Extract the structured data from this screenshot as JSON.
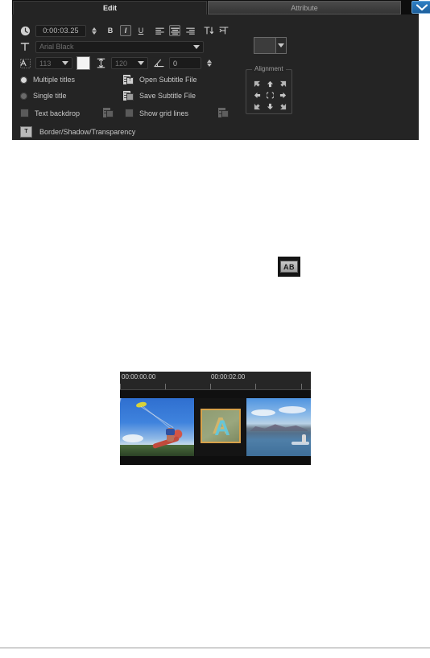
{
  "panel": {
    "tabs": [
      {
        "id": "edit",
        "label": "Edit",
        "active": true
      },
      {
        "id": "attribute",
        "label": "Attribute",
        "active": false
      }
    ],
    "expand_icon": "chevron-down-icon",
    "duration": {
      "icon": "clock-icon",
      "value": "0:00:03.25"
    },
    "text_style": {
      "bold_label": "B",
      "italic_label": "I",
      "underline_label": "U",
      "align_left_icon": "align-left-icon",
      "align_center_icon": "align-center-icon",
      "align_right_icon": "align-right-icon",
      "text_direction_horizontal_icon": "text-direction-horizontal-icon",
      "text_direction_vertical_icon": "text-direction-vertical-icon",
      "italic_active": true,
      "align_center_active": true
    },
    "font": {
      "icon": "font-type-icon",
      "family": "Arial Black",
      "size": "113",
      "size_icon": "font-size-icon",
      "line_spacing": "120",
      "line_spacing_icon": "line-spacing-icon",
      "rotation": "0",
      "rotation_icon": "rotation-angle-icon",
      "color_swatch": "#3c3c3c"
    },
    "options": {
      "multiple_titles": "Multiple titles",
      "single_title": "Single title",
      "text_backdrop": "Text backdrop",
      "show_grid_lines": "Show grid lines",
      "multiple_titles_selected": true,
      "single_title_selected": false,
      "text_backdrop_checked": false,
      "show_grid_lines_checked": false
    },
    "subtitle": {
      "open_label": "Open Subtitle File",
      "open_icon": "open-subtitle-file-icon",
      "save_label": "Save Subtitle File",
      "save_icon": "save-subtitle-file-icon"
    },
    "border_shadow": {
      "label": "Border/Shadow/Transparency",
      "icon": "text-box-icon"
    },
    "alignment": {
      "legend": "Alignment",
      "cells": [
        "align-top-left-icon",
        "align-top-center-icon",
        "align-top-right-icon",
        "align-middle-left-icon",
        "align-center-center-icon",
        "align-middle-right-icon",
        "align-bottom-left-icon",
        "align-bottom-center-icon",
        "align-bottom-right-icon"
      ]
    },
    "extra_icons": {
      "backdrop_preview_icon": "text-backdrop-preview-icon",
      "grid_preview_icon": "grid-preview-icon"
    },
    "colors": {
      "panel_bg": "#242424",
      "tab_bg": "#0d0d0d",
      "accent_blue": "#2e7fc4",
      "field_bg": "#1b1b1b",
      "text": "#c8c8c8"
    }
  },
  "ab_button": {
    "label": "AB",
    "name": "ab-transition-button"
  },
  "timeline": {
    "ruler_labels": [
      "00:00:00.00",
      "00:00:02.00"
    ],
    "clips": [
      {
        "id": "clip-1",
        "name": "kitesurf-video-clip",
        "selected": false
      },
      {
        "id": "clip-2",
        "name": "title-clip",
        "selected": true,
        "glyph": "A"
      },
      {
        "id": "clip-3",
        "name": "ocean-video-clip",
        "selected": false
      }
    ]
  }
}
